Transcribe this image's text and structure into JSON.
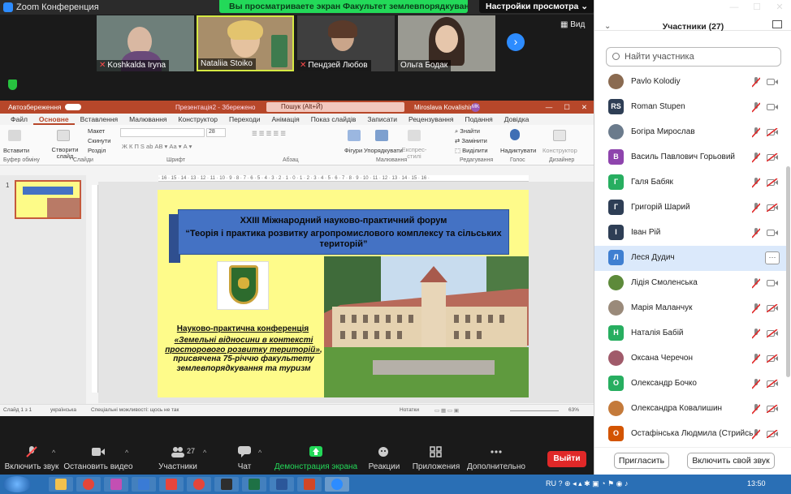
{
  "window": {
    "title": "Zoom Конференция",
    "minimize": "—",
    "maximize": "☐",
    "close": "✕"
  },
  "banner": {
    "viewing": "Вы просматриваете экран Факультет землевпорядкування т...",
    "view_options": "Настройки просмотра ⌄"
  },
  "video": {
    "tiles": [
      {
        "name": "Koshkalda Iryna",
        "muted": true
      },
      {
        "name": "Nataliia Stoiko",
        "muted": false
      },
      {
        "name": "Пендзей Любов",
        "muted": true
      },
      {
        "name": "Ольга Бодак",
        "muted": false
      }
    ],
    "view_label": "Вид"
  },
  "ppt": {
    "autosave": "Автозбереження",
    "file": "Презентація2 - Збережено",
    "search": "Пошук (Alt+Й)",
    "user": "Miroslava Kovalishin",
    "user_initials": "MK",
    "tabs": [
      "Файл",
      "Основне",
      "Вставлення",
      "Малювання",
      "Конструктор",
      "Переходи",
      "Анімація",
      "Показ слайдів",
      "Записати",
      "Рецензування",
      "Подання",
      "Довідка"
    ],
    "ribbon": {
      "paste": "Вставити",
      "clipboard": "Буфер обміну",
      "new_slide": "Створити слайд",
      "layout": "Макет",
      "reset": "Скинути",
      "section": "Розділ",
      "slides": "Слайди",
      "font": "Шрифт",
      "font_size": "28",
      "paragraph": "Абзац",
      "shapes": "Фігури",
      "arrange": "Упорядкувати",
      "quick_styles": "Експрес-стилі",
      "drawing": "Малювання",
      "find": "Знайти",
      "replace": "Замінити",
      "select": "Виділити",
      "editing": "Редагування",
      "dictate": "Надиктувати",
      "voice": "Голос",
      "designer": "Конструктор",
      "designer_group": "Дизайнер"
    },
    "ruler": "· 16 · 15 · 14 · 13 · 12 · 11 · 10 · 9 · 8 · 7 · 6 · 5 · 4 · 3 · 2 · 1 · 0 · 1 · 2 · 3 · 4 · 5 · 6 · 7 · 8 · 9 · 10 · 11 · 12 · 13 · 14 · 15 · 16 ·",
    "thumb_number": "1",
    "slide": {
      "forum_line1": "XXIII Міжнародний науково-практичний форум",
      "forum_line2": "“Теорія і практика розвитку агропромислового комплексу та сільських територій”",
      "conf_title": "Науково-практична конференція",
      "conf_body_underlined": "«Земельні відносини в контексті просторового розвитку територій»",
      "conf_body_rest": ", присвячена 75-річчю факультету землевпорядкування та туризм"
    },
    "status": {
      "slide": "Слайд 1 з 1",
      "language": "українська",
      "accessibility": "Спеціальні можливості: щось не так",
      "notes": "Нотатки",
      "zoom": "63%"
    }
  },
  "controls": {
    "mute": "Включить звук",
    "video": "Остановить видео",
    "participants": "Участники",
    "participants_count": "27",
    "chat": "Чат",
    "share": "Демонстрация экрана",
    "reactions": "Реакции",
    "apps": "Приложения",
    "more": "Дополнительно",
    "leave": "Выйти"
  },
  "panel": {
    "title": "Участники (27)",
    "search_placeholder": "Найти участника",
    "participants": [
      {
        "initial": "",
        "name": "Pavlo Kolodiy",
        "color": "#8a6a50",
        "photo": true,
        "cam_off": false
      },
      {
        "initial": "RS",
        "name": "Roman Stupen",
        "color": "#2e3e55",
        "photo": false,
        "cam_off": false
      },
      {
        "initial": "",
        "name": "Богіра Мирослав",
        "color": "#6b7b8c",
        "photo": true,
        "cam_off": true
      },
      {
        "initial": "В",
        "name": "Василь Павлович Горьовий",
        "color": "#8e44ad",
        "photo": false,
        "cam_off": true
      },
      {
        "initial": "Г",
        "name": "Галя Бабяк",
        "color": "#27ae60",
        "photo": false,
        "cam_off": true
      },
      {
        "initial": "Г",
        "name": "Григорій Шарий",
        "color": "#2e3e55",
        "photo": false,
        "cam_off": true
      },
      {
        "initial": "І",
        "name": "Іван Рій",
        "color": "#2e3e55",
        "photo": false,
        "cam_off": false
      },
      {
        "initial": "Л",
        "name": "Леся Дудич",
        "color": "#3f7fd1",
        "photo": false,
        "cam_off": false,
        "selected": true
      },
      {
        "initial": "",
        "name": "Лідія Смоленська",
        "color": "#5d8a3a",
        "photo": true,
        "cam_off": false
      },
      {
        "initial": "",
        "name": "Марія Маланчук",
        "color": "#9a8a7a",
        "photo": true,
        "cam_off": true
      },
      {
        "initial": "Н",
        "name": "Наталія Бабій",
        "color": "#27ae60",
        "photo": false,
        "cam_off": true
      },
      {
        "initial": "",
        "name": "Оксана Черечон",
        "color": "#a05a6a",
        "photo": true,
        "cam_off": true
      },
      {
        "initial": "О",
        "name": "Олександр Бочко",
        "color": "#27ae60",
        "photo": false,
        "cam_off": true
      },
      {
        "initial": "",
        "name": "Олександра Ковалишин",
        "color": "#c47a3a",
        "photo": true,
        "cam_off": true
      },
      {
        "initial": "О",
        "name": "Остафінська Людмила (Стрийсь...",
        "color": "#d35400",
        "photo": false,
        "cam_off": true
      }
    ],
    "invite": "Пригласить",
    "unmute_me": "Включить свой звук",
    "more_btn": "···"
  },
  "taskbar": {
    "lang": "RU",
    "time": "13:50"
  }
}
